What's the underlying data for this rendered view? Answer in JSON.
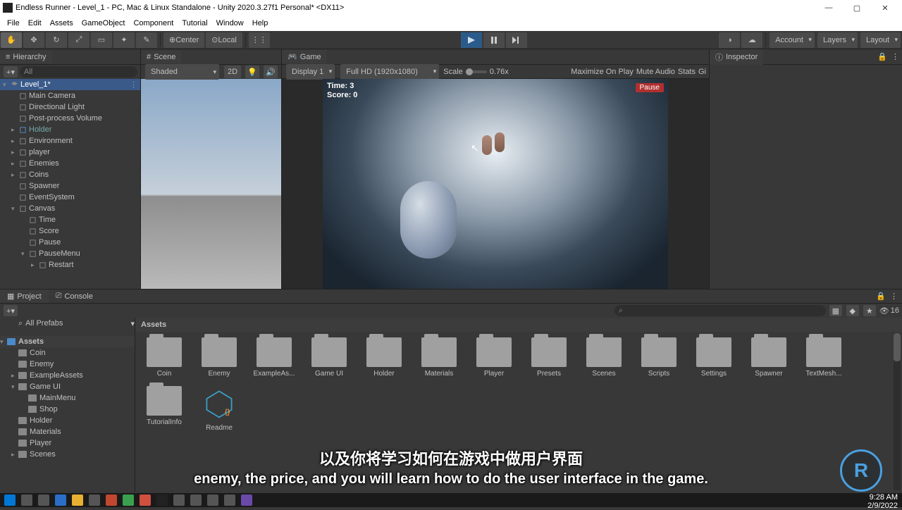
{
  "window": {
    "title": "Endless Runner - Level_1 - PC, Mac & Linux Standalone - Unity 2020.3.27f1 Personal* <DX11>"
  },
  "menus": [
    "File",
    "Edit",
    "Assets",
    "GameObject",
    "Component",
    "Tutorial",
    "Window",
    "Help"
  ],
  "toolbar": {
    "pivot": "Center",
    "handle": "Local",
    "account": "Account",
    "layers": "Layers",
    "layout": "Layout"
  },
  "tabs": {
    "hierarchy": "Hierarchy",
    "scene": "Scene",
    "game": "Game",
    "inspector": "Inspector",
    "project": "Project",
    "console": "Console"
  },
  "hierarchy": {
    "search_placeholder": "All",
    "root": "Level_1*",
    "items": [
      "Main Camera",
      "Directional Light",
      "Post-process Volume",
      "Holder",
      "Environment",
      "player",
      "Enemies",
      "Coins",
      "Spawner",
      "EventSystem",
      "Canvas"
    ],
    "canvas_children": [
      "Time",
      "Score",
      "Pause",
      "PauseMenu"
    ],
    "pausemenu_children": [
      "Restart"
    ]
  },
  "scene_panel": {
    "shading": "Shaded",
    "mode": "2D"
  },
  "game_panel": {
    "display": "Display 1",
    "resolution": "Full HD (1920x1080)",
    "scale_label": "Scale",
    "scale_value": "0.76x",
    "maximize": "Maximize On Play",
    "mute": "Mute Audio",
    "stats": "Stats",
    "gizmos": "Gi",
    "hud_time": "Time: 3",
    "hud_score": "Score: 0",
    "pause": "Pause"
  },
  "project": {
    "favorites_label": "All Prefabs",
    "assets_root": "Assets",
    "tree": [
      "Coin",
      "Enemy",
      "ExampleAssets",
      "Game UI",
      "MainMenu",
      "Shop",
      "Holder",
      "Materials",
      "Player",
      "Scenes"
    ],
    "breadcrumb": "Assets",
    "grid": [
      "Coin",
      "Enemy",
      "ExampleAs...",
      "Game UI",
      "Holder",
      "Materials",
      "Player",
      "Presets",
      "Scenes",
      "Scripts",
      "Settings",
      "Spawner",
      "TextMesh...",
      "TutorialInfo"
    ],
    "readme": "Readme",
    "visible_count": "16"
  },
  "system": {
    "time": "9:28 AM",
    "date": "2/9/2022"
  },
  "subtitles": {
    "cn": "以及你将学习如何在游戏中做用户界面",
    "en": "enemy, the price, and you will learn how to do the user interface in the game."
  }
}
